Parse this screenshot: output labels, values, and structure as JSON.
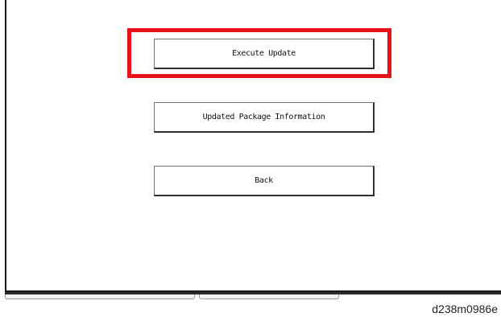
{
  "buttons": {
    "execute_update": "Execute Update",
    "updated_package_information": "Updated Package Information",
    "back": "Back"
  },
  "highlight": {
    "target": "execute_update",
    "color": "#e8121a"
  },
  "figure_id": "d238m0986e"
}
